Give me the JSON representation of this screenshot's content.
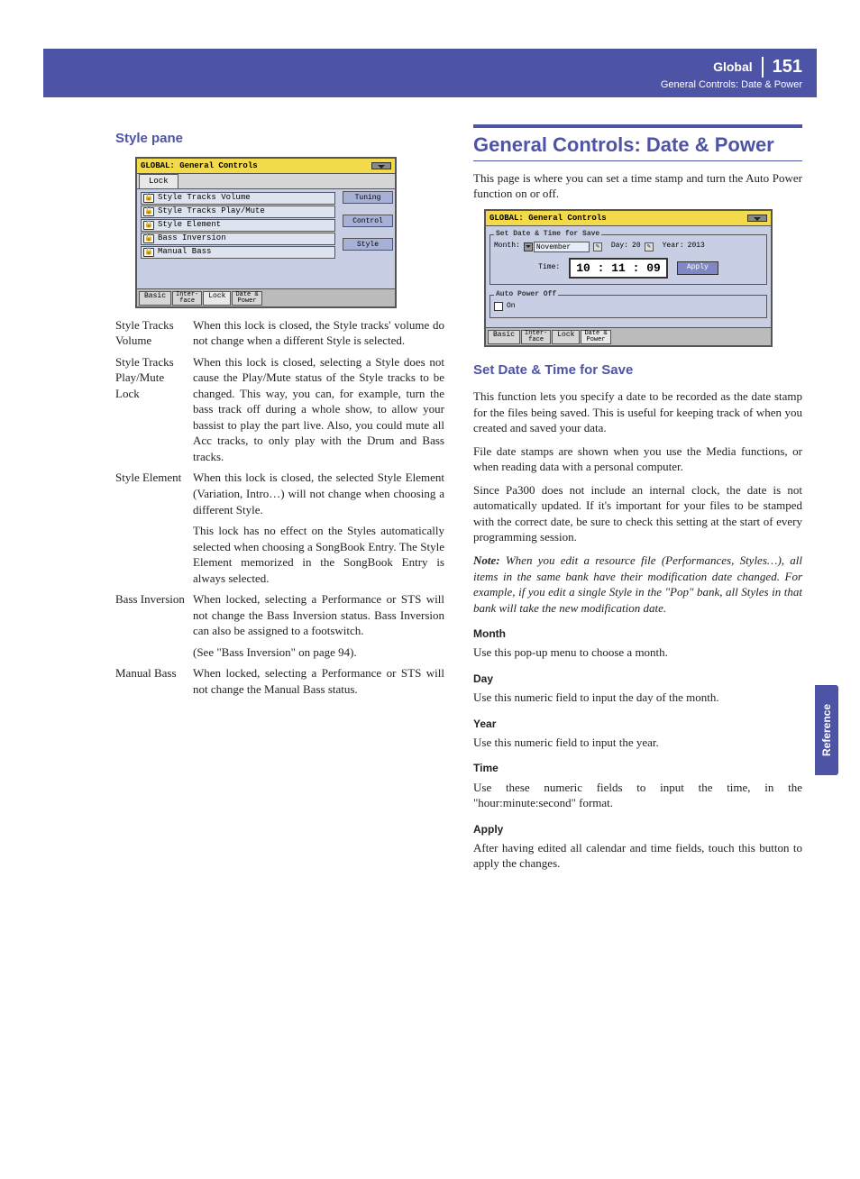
{
  "header": {
    "section": "Global",
    "page": "151",
    "subtitle": "General Controls: Date & Power"
  },
  "sideTab": "Reference",
  "col1": {
    "h3": "Style pane",
    "screenshot1": {
      "title": "GLOBAL: General Controls",
      "topTab": "Lock",
      "items": [
        {
          "unlocked": true,
          "glyph": "🔓",
          "label": "Style Tracks Volume"
        },
        {
          "unlocked": true,
          "glyph": "🔓",
          "label": "Style Tracks Play/Mute"
        },
        {
          "unlocked": false,
          "glyph": "🔒",
          "label": "Style Element"
        },
        {
          "unlocked": true,
          "glyph": "🔓",
          "label": "Bass Inversion"
        },
        {
          "unlocked": false,
          "glyph": "🔒",
          "label": "Manual Bass"
        }
      ],
      "sideLabels": [
        "Tuning",
        "Control",
        "Style"
      ],
      "bottomTabs": [
        "Basic",
        "Inter-\nface",
        "Lock",
        "Date &\nPower"
      ],
      "bottomActive": 2
    },
    "defs": [
      {
        "label": "Style Tracks Volume",
        "paras": [
          "When this lock is closed, the Style tracks' volume do not change when a different Style is selected."
        ]
      },
      {
        "label": "Style Tracks Play/Mute Lock",
        "paras": [
          "When this lock is closed, selecting a Style does not cause the Play/Mute status of the Style tracks to be changed. This way, you can, for example, turn the bass track off during a whole show, to allow your bassist to play the part live. Also, you could mute all Acc tracks, to only play with the Drum and Bass tracks."
        ]
      },
      {
        "label": "Style Element",
        "paras": [
          "When this lock is closed, the selected Style Element (Variation, Intro…) will not change when choosing a different Style.",
          "This lock has no effect on the Styles automatically selected when choosing a SongBook Entry. The Style Element memorized in the SongBook Entry is always selected."
        ]
      },
      {
        "label": "Bass Inversion",
        "paras": [
          "When locked, selecting a Performance or STS will not change the Bass Inversion status. Bass Inversion can also be assigned to a footswitch.",
          "(See \"Bass Inversion\" on page 94)."
        ]
      },
      {
        "label": "Manual Bass",
        "paras": [
          "When locked, selecting a Performance or STS will not change the Manual Bass status."
        ]
      }
    ]
  },
  "col2": {
    "h2": "General Controls: Date & Power",
    "intro": "This page is where you can set a time stamp and turn the Auto Power function on or off.",
    "screenshot2": {
      "title": "GLOBAL: General Controls",
      "legend1": "Set Date & Time for Save",
      "month_label": "Month:",
      "month_value": "November",
      "day_label": "Day:",
      "day_value": "20",
      "year_label": "Year:",
      "year_value": "2013",
      "time_label": "Time:",
      "time_value": "10 : 11 : 09",
      "apply": "Apply",
      "legend2": "Auto Power Off",
      "on_label": "On",
      "on_checked": false,
      "bottomTabs": [
        "Basic",
        "Inter-\nface",
        "Lock",
        "Date &\nPower"
      ],
      "bottomActive": 3
    },
    "h3": "Set Date & Time for Save",
    "paras": [
      "This function lets you specify a date to be recorded as the date stamp for the files being saved. This is useful for keeping track of when you created and saved your data.",
      "File date stamps are shown when you use the Media functions, or when reading data with a personal computer.",
      "Since Pa300 does not include an internal clock, the date is not automatically updated. If it's important for your files to be stamped with the correct date, be sure to check this setting at the start of every programming session."
    ],
    "note_bold": "Note:",
    "note": " When you edit a resource file (Performances, Styles…), all items in the same bank have their modification date changed. For example, if you edit a single Style in the \"Pop\" bank, all Styles in that bank will take the new modification date.",
    "fields": [
      {
        "h": "Month",
        "p": "Use this pop-up menu to choose a month."
      },
      {
        "h": "Day",
        "p": "Use this numeric field to input the day of the month."
      },
      {
        "h": "Year",
        "p": "Use this numeric field to input the year."
      },
      {
        "h": "Time",
        "p": "Use these numeric fields to input the time, in the \"hour:minute:second\" format."
      },
      {
        "h": "Apply",
        "p": "After having edited all calendar and time fields, touch this button to apply the changes."
      }
    ]
  }
}
